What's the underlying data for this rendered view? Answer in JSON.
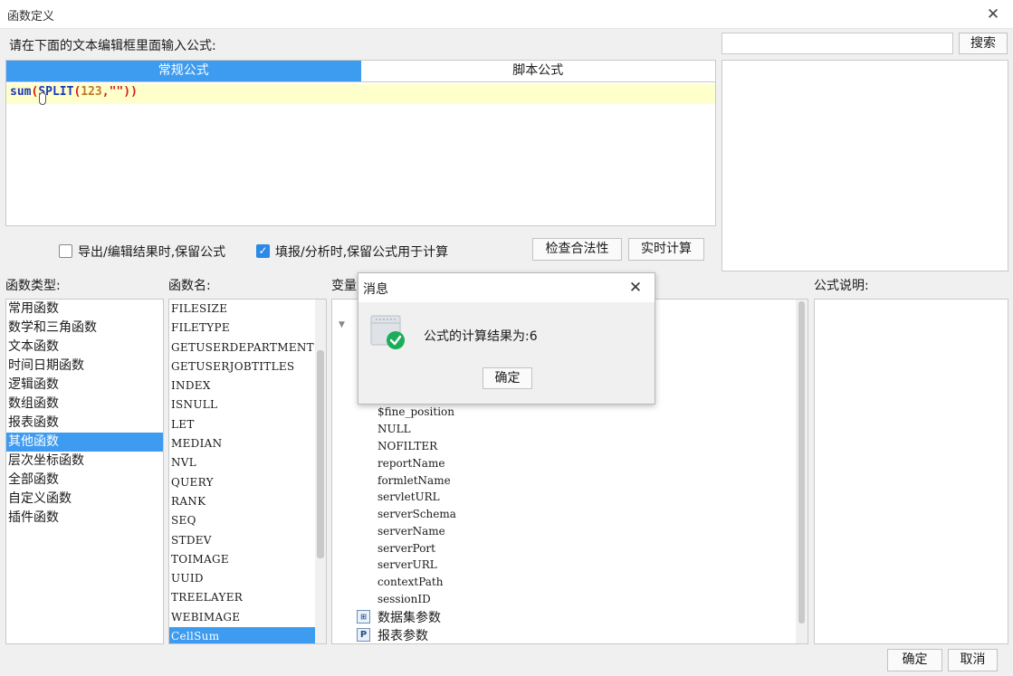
{
  "window": {
    "title": "函数定义"
  },
  "header": {
    "prompt": "请在下面的文本编辑框里面输入公式:"
  },
  "search": {
    "value": "",
    "button": "搜索"
  },
  "editor": {
    "tabs": [
      {
        "label": "常规公式",
        "active": true
      },
      {
        "label": "脚本公式",
        "active": false
      }
    ],
    "formula": {
      "p1": "sum",
      "p2": "(",
      "p3": "SPLIT",
      "p4": "(",
      "p5": "123",
      "p6": ",",
      "p7": "\"\"",
      "p8": "))"
    }
  },
  "options": {
    "keep_formula_export": {
      "label": "导出/编辑结果时,保留公式",
      "checked": false
    },
    "keep_formula_fill": {
      "label": "填报/分析时,保留公式用于计算",
      "checked": true
    }
  },
  "buttons": {
    "check": "检查合法性",
    "realtime": "实时计算",
    "ok": "确定",
    "cancel": "取消"
  },
  "panels": {
    "category_label": "函数类型:",
    "name_label": "函数名:",
    "var_label": "变量",
    "desc_label": "公式说明:"
  },
  "categories": [
    {
      "label": "常用函数"
    },
    {
      "label": "数学和三角函数"
    },
    {
      "label": "文本函数"
    },
    {
      "label": "时间日期函数"
    },
    {
      "label": "逻辑函数"
    },
    {
      "label": "数组函数"
    },
    {
      "label": "报表函数"
    },
    {
      "label": "其他函数",
      "selected": true
    },
    {
      "label": "层次坐标函数"
    },
    {
      "label": "全部函数"
    },
    {
      "label": "自定义函数"
    },
    {
      "label": "插件函数"
    }
  ],
  "functions": [
    {
      "label": "FILESIZE"
    },
    {
      "label": "FILETYPE"
    },
    {
      "label": "GETUSERDEPARTMENTS"
    },
    {
      "label": "GETUSERJOBTITLES"
    },
    {
      "label": "INDEX"
    },
    {
      "label": "ISNULL"
    },
    {
      "label": "LET"
    },
    {
      "label": "MEDIAN"
    },
    {
      "label": "NVL"
    },
    {
      "label": "QUERY"
    },
    {
      "label": "RANK"
    },
    {
      "label": "SEQ"
    },
    {
      "label": "STDEV"
    },
    {
      "label": "TOIMAGE"
    },
    {
      "label": "UUID"
    },
    {
      "label": "TREELAYER"
    },
    {
      "label": "WEBIMAGE"
    },
    {
      "label": "CellSum",
      "selected": true
    }
  ],
  "variables": {
    "items": [
      "$fine_position",
      "NULL",
      "NOFILTER",
      "reportName",
      "formletName",
      "servletURL",
      "serverSchema",
      "serverName",
      "serverPort",
      "serverURL",
      "contextPath",
      "sessionID"
    ],
    "dataset_params": "数据集参数",
    "report_params": "报表参数",
    "report_params_icon": "P"
  },
  "dialog": {
    "title": "消息",
    "message": "公式的计算结果为:6",
    "ok": "确定",
    "icon": "success-check-icon"
  },
  "colors": {
    "accent": "#3d9bf0",
    "success": "#1aae5a",
    "editor_highlight": "#ffffcc"
  }
}
